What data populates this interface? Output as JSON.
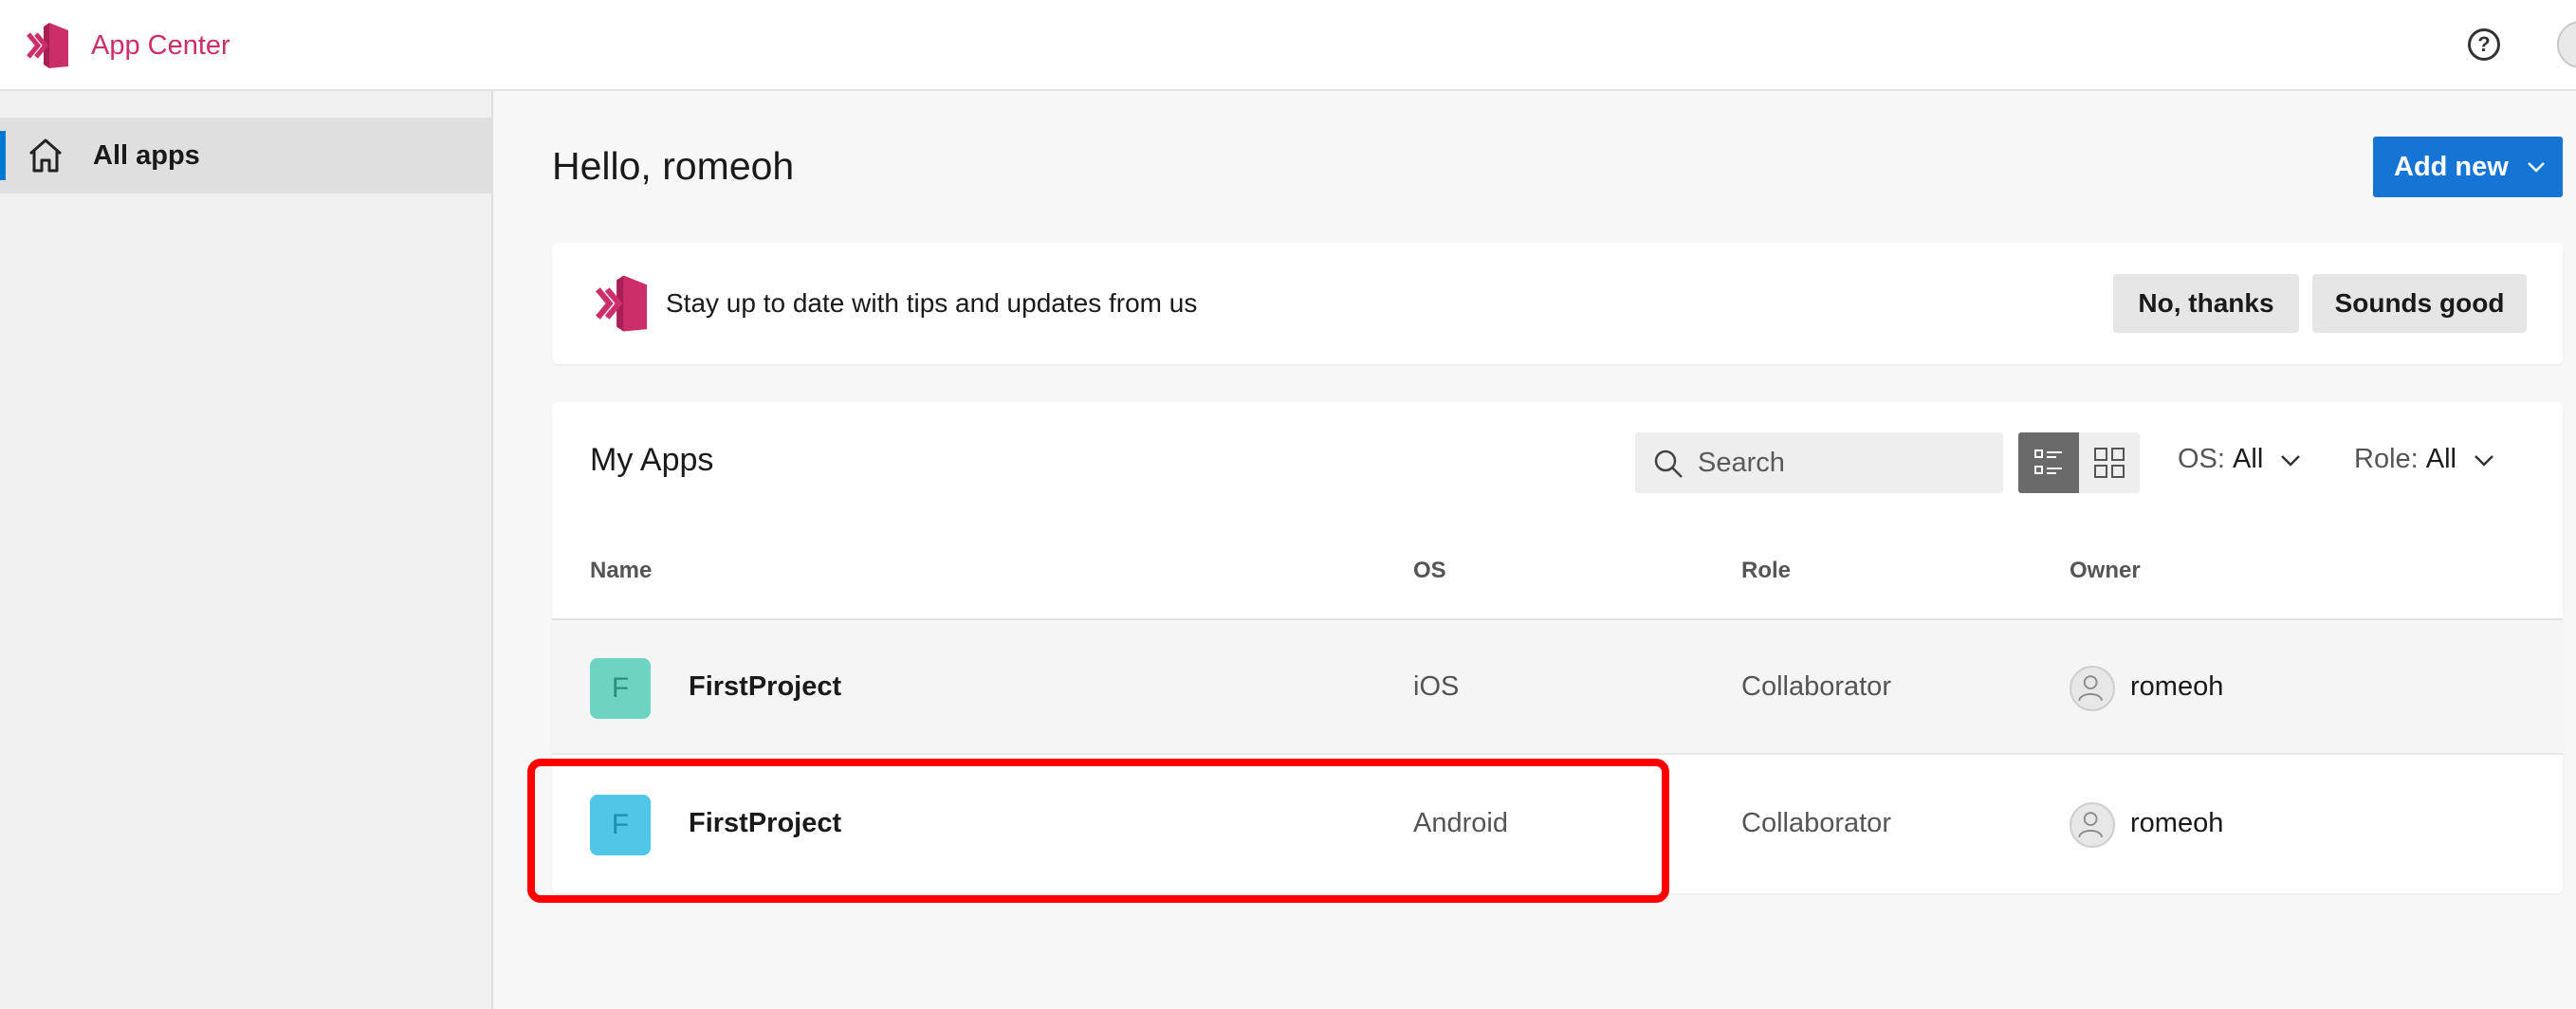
{
  "header": {
    "brand": "App Center",
    "help_label": "?"
  },
  "sidebar": {
    "items": [
      {
        "label": "All apps",
        "icon": "home-icon",
        "active": true
      }
    ]
  },
  "main": {
    "greeting": "Hello, romeoh",
    "add_new_label": "Add new",
    "tips": {
      "message": "Stay up to date with tips and updates from us",
      "no_label": "No, thanks",
      "yes_label": "Sounds good"
    },
    "apps": {
      "title": "My Apps",
      "search_placeholder": "Search",
      "filters": {
        "os_key": "OS:",
        "os_value": "All",
        "role_key": "Role:",
        "role_value": "All"
      },
      "columns": [
        "Name",
        "OS",
        "Role",
        "Owner"
      ],
      "rows": [
        {
          "initial": "F",
          "name": "FirstProject",
          "os": "iOS",
          "role": "Collaborator",
          "owner": "romeoh",
          "icon_color": "#6fd3c2"
        },
        {
          "initial": "F",
          "name": "FirstProject",
          "os": "Android",
          "role": "Collaborator",
          "owner": "romeoh",
          "icon_color": "#52c6e6"
        }
      ]
    }
  },
  "colors": {
    "brand": "#cc2e6a",
    "primary": "#1674d4",
    "highlight": "#ff0000"
  }
}
